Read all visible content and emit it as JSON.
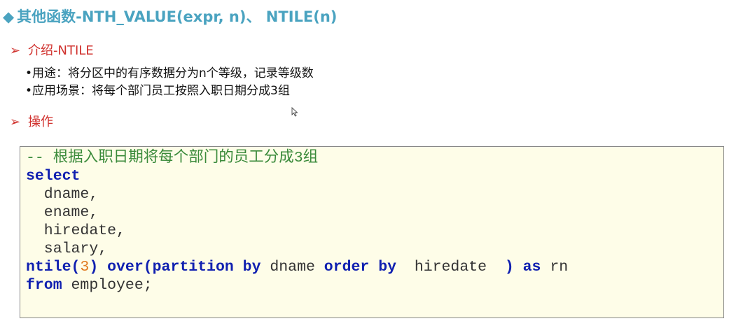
{
  "title": {
    "bullet_icon": "diamond-icon",
    "text": "其他函数-NTH_VALUE(expr, n)、 NTILE(n)"
  },
  "sections": [
    {
      "icon": "arrow-bullet-icon",
      "label": "介绍-NTILE"
    },
    {
      "icon": "arrow-bullet-icon",
      "label": "操作"
    }
  ],
  "bullets": [
    "•用途：将分区中的有序数据分为n个等级，记录等级数",
    "•应用场景：将每个部门员工按照入职日期分成3组"
  ],
  "colors": {
    "title": "#4aa3c0",
    "section": "#d0312d",
    "keyword": "#1020b0",
    "comment": "#3a8a3a",
    "code_bg": "#fefde8"
  },
  "code_lines": [
    [
      {
        "t": "cm",
        "v": "-- 根据入职日期将每个部门的员工分成3组"
      }
    ],
    [
      {
        "t": "kw",
        "v": "select"
      }
    ],
    [
      {
        "t": "plain",
        "v": "  dname,"
      }
    ],
    [
      {
        "t": "plain",
        "v": "  ename,"
      }
    ],
    [
      {
        "t": "plain",
        "v": "  hiredate,"
      }
    ],
    [
      {
        "t": "plain",
        "v": "  salary,"
      }
    ],
    [
      {
        "t": "kw",
        "v": "ntile("
      },
      {
        "t": "num",
        "v": "3"
      },
      {
        "t": "kw",
        "v": ") over(partition by"
      },
      {
        "t": "plain",
        "v": " dname "
      },
      {
        "t": "kw",
        "v": "order by"
      },
      {
        "t": "plain",
        "v": "  hiredate  "
      },
      {
        "t": "kw",
        "v": ") as"
      },
      {
        "t": "plain",
        "v": " rn"
      }
    ],
    [
      {
        "t": "kw",
        "v": "from"
      },
      {
        "t": "plain",
        "v": " employee;"
      }
    ]
  ]
}
